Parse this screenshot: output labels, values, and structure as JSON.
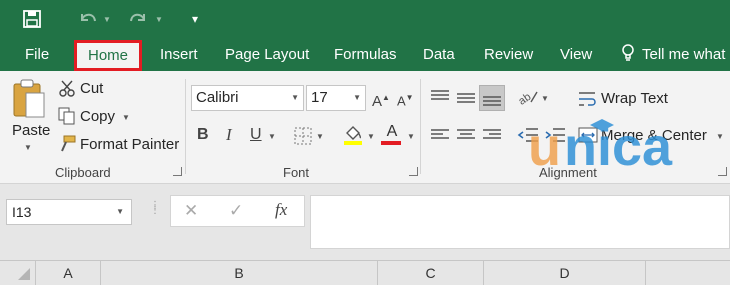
{
  "qat": {
    "save_icon": "save-icon",
    "undo_icon": "undo-icon",
    "redo_icon": "redo-icon",
    "customize_icon": "customize-qat-icon"
  },
  "tabs": {
    "file": "File",
    "home": "Home",
    "insert": "Insert",
    "page_layout": "Page Layout",
    "formulas": "Formulas",
    "data": "Data",
    "review": "Review",
    "view": "View",
    "tell_me": "Tell me what"
  },
  "clipboard": {
    "paste": "Paste",
    "cut": "Cut",
    "copy": "Copy",
    "format_painter": "Format Painter",
    "group_label": "Clipboard"
  },
  "font": {
    "family": "Calibri",
    "size": "17",
    "bold": "B",
    "italic": "I",
    "underline": "U",
    "font_color": "A",
    "group_label": "Font",
    "highlight_color": "#ffff00",
    "text_color": "#e31c23"
  },
  "alignment": {
    "wrap_text": "Wrap Text",
    "merge_center": "Merge & Center",
    "group_label": "Alignment"
  },
  "formula_bar": {
    "name_box": "I13",
    "cancel": "✕",
    "enter": "✓",
    "fx": "fx",
    "content": ""
  },
  "columns": [
    "A",
    "B",
    "C",
    "D"
  ],
  "watermark": "unica",
  "colors": {
    "excel_green": "#217346",
    "highlight_red": "#e31c23",
    "watermark_orange": "#f0a04b",
    "watermark_blue": "#2b8fd6"
  }
}
